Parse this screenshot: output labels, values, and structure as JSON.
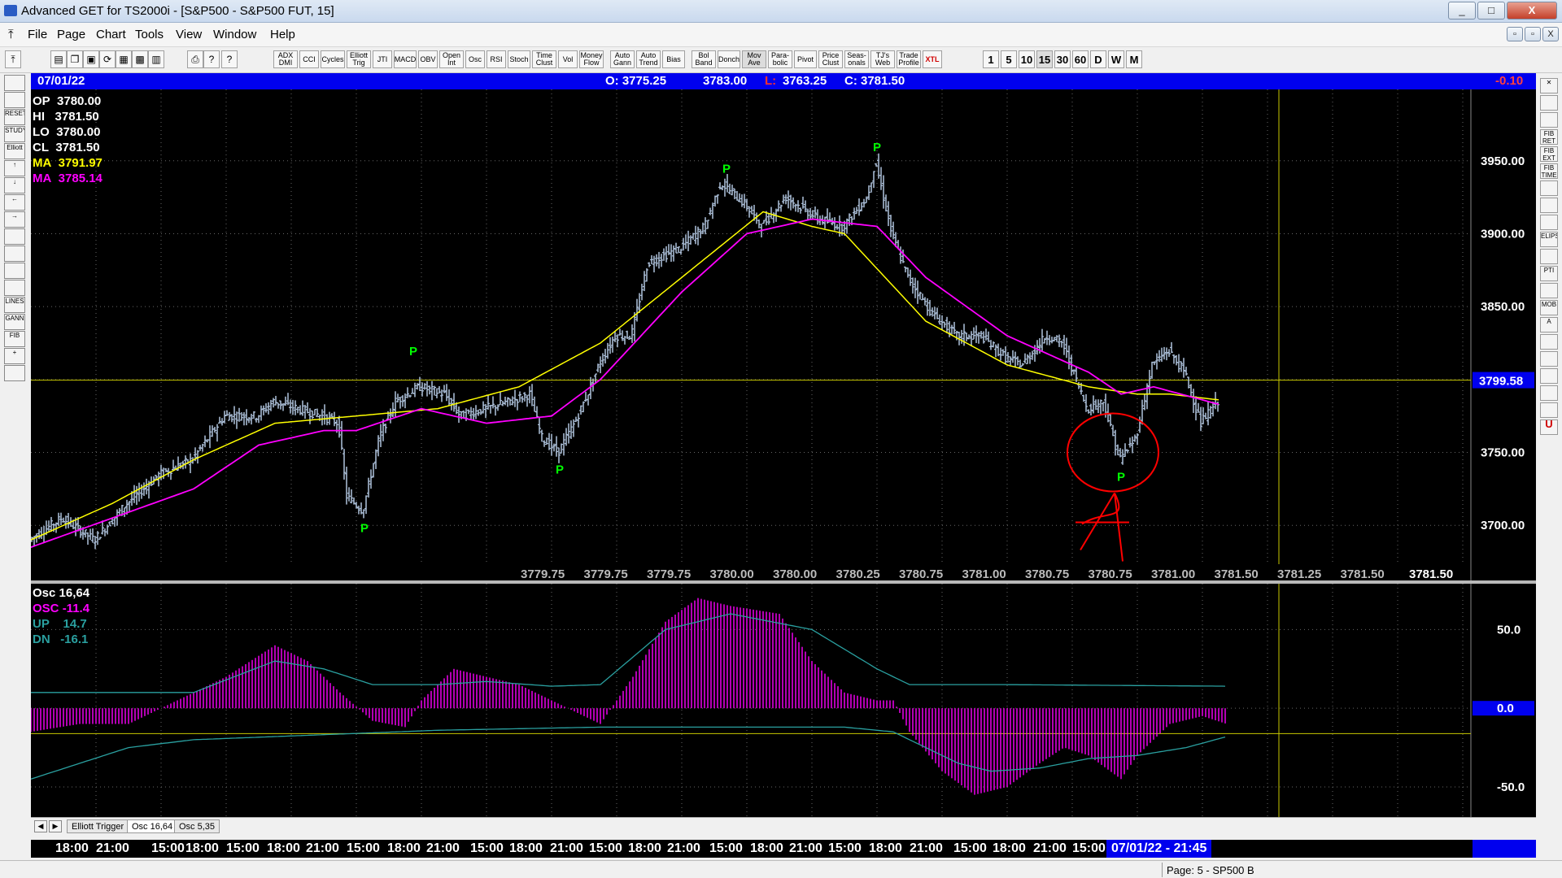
{
  "window": {
    "title": "Advanced GET for TS2000i - [S&P500 - S&P500 FUT, 15]",
    "buttons": [
      "_",
      "□",
      "X"
    ],
    "mdi_buttons": [
      "▫",
      "▫",
      "X"
    ]
  },
  "menu": [
    "File",
    "Page",
    "Chart",
    "Tools",
    "View",
    "Window",
    "Help"
  ],
  "toolbar": {
    "study_buttons": [
      "ADX DMI",
      "CCI",
      "Cycles",
      "Elliott Trig",
      "JTI",
      "MACD",
      "OBV",
      "Open Int",
      "Osc",
      "RSI",
      "Stoch",
      "Time Clust",
      "Vol",
      "Money Flow",
      "Auto Gann",
      "Auto Trend",
      "Bias",
      "Bol Band",
      "Donch",
      "Mov Ave",
      "Para-bolic",
      "Pivot",
      "Price Clust",
      "Seas-onals",
      "TJ's Web",
      "Trade Profile",
      "XTL"
    ],
    "timeframes": [
      "1",
      "5",
      "10",
      "15",
      "30",
      "60",
      "D",
      "W",
      "M"
    ],
    "selected_timeframe": "15"
  },
  "left_tools": [
    "",
    "",
    "RESET",
    "STUDY",
    "Elliott",
    "↑",
    "↓",
    "←",
    "→",
    "",
    "",
    "",
    "",
    "LINES",
    "GANN",
    "FIB",
    "+",
    ""
  ],
  "right_tools": [
    "✕",
    "",
    "",
    "FIB RET",
    "FIB EXT",
    "FIB TIME",
    "",
    "",
    "",
    "ELIPS",
    "",
    "PTI",
    "",
    "MOB",
    "A",
    "",
    "",
    "",
    "",
    "",
    "U"
  ],
  "header_bar": {
    "date": "07/01/22",
    "open": "O: 3775.25",
    "high": "3783.00",
    "low_label": "L:",
    "low": "3763.25",
    "close": "C: 3781.50",
    "change": "-0.10"
  },
  "price_panel": {
    "legend": [
      {
        "label": "OP",
        "value": "3780.00",
        "color": "#ffffff"
      },
      {
        "label": "HI",
        "value": "3781.50",
        "color": "#ffffff"
      },
      {
        "label": "LO",
        "value": "3780.00",
        "color": "#ffffff"
      },
      {
        "label": "CL",
        "value": "3781.50",
        "color": "#ffffff"
      },
      {
        "label": "MA",
        "value": "3791.97",
        "color": "#ffff00"
      },
      {
        "label": "MA",
        "value": "3785.14",
        "color": "#ff00ff"
      }
    ],
    "ticks": [
      "3950.00",
      "3900.00",
      "3850.00",
      "3750.00",
      "3700.00"
    ],
    "current_price_label": "3799.58",
    "bottom_values": [
      "3779.75",
      "3779.75",
      "3779.75",
      "3780.00",
      "3780.00",
      "3780.25",
      "3780.75",
      "3781.00",
      "3780.75",
      "3780.75",
      "3781.00",
      "3781.50",
      "3781.25",
      "3781.50",
      "3781.50"
    ],
    "pivot_marker": "P"
  },
  "osc_panel": {
    "legend": [
      {
        "label": "Osc 16,64",
        "value": "",
        "color": "#ffffff"
      },
      {
        "label": "OSC",
        "value": "-11.4",
        "color": "#ff00ff"
      },
      {
        "label": "UP",
        "value": "14.7",
        "color": "#2aa0a0"
      },
      {
        "label": "DN",
        "value": "-16.1",
        "color": "#2aa0a0"
      }
    ],
    "ticks": [
      "50.0",
      "0.0",
      "-50.0"
    ]
  },
  "tabs": [
    "Elliott Trigger",
    "Osc 16,64",
    "Osc 5,35"
  ],
  "active_tab": "Osc 16,64",
  "time_axis": {
    "labels": [
      "18:00",
      "21:00",
      "15:00",
      "18:00",
      "15:00",
      "18:00",
      "21:00",
      "15:00",
      "18:00",
      "21:00",
      "15:00",
      "18:00",
      "21:00",
      "15:00",
      "18:00",
      "21:00",
      "15:00",
      "18:00",
      "21:00",
      "15:00",
      "18:00",
      "21:00",
      "15:00",
      "18:00",
      "21:00",
      "15:00"
    ],
    "cursor_label": "07/01/22 - 21:45"
  },
  "status": "Page: 5 - SP500 B",
  "colors": {
    "bars": "#b0c4de",
    "ma_fast": "#ffff00",
    "ma_slow": "#ff00ff",
    "pivot": "#00ff00",
    "osc": "#ff00ff",
    "osc_band": "#2aa0a0",
    "annotation": "#ff0000",
    "cursor": "#c8c800"
  },
  "chart_data": {
    "type": "ohlc",
    "instrument": "S&P500 FUT, 15",
    "price_ylim": [
      3670,
      3990
    ],
    "price_path": [
      [
        0,
        3690
      ],
      [
        40,
        3705
      ],
      [
        80,
        3690
      ],
      [
        120,
        3715
      ],
      [
        160,
        3735
      ],
      [
        200,
        3745
      ],
      [
        240,
        3775
      ],
      [
        280,
        3775
      ],
      [
        300,
        3785
      ],
      [
        330,
        3780
      ],
      [
        360,
        3775
      ],
      [
        380,
        3770
      ],
      [
        390,
        3720
      ],
      [
        410,
        3710
      ],
      [
        430,
        3760
      ],
      [
        450,
        3785
      ],
      [
        480,
        3795
      ],
      [
        510,
        3790
      ],
      [
        530,
        3775
      ],
      [
        560,
        3780
      ],
      [
        590,
        3785
      ],
      [
        615,
        3790
      ],
      [
        630,
        3760
      ],
      [
        650,
        3750
      ],
      [
        670,
        3770
      ],
      [
        690,
        3795
      ],
      [
        700,
        3810
      ],
      [
        720,
        3830
      ],
      [
        740,
        3830
      ],
      [
        760,
        3880
      ],
      [
        800,
        3890
      ],
      [
        830,
        3905
      ],
      [
        850,
        3935
      ],
      [
        880,
        3920
      ],
      [
        900,
        3905
      ],
      [
        930,
        3925
      ],
      [
        970,
        3910
      ],
      [
        1000,
        3905
      ],
      [
        1030,
        3925
      ],
      [
        1040,
        3950
      ],
      [
        1060,
        3900
      ],
      [
        1080,
        3870
      ],
      [
        1110,
        3845
      ],
      [
        1140,
        3830
      ],
      [
        1170,
        3830
      ],
      [
        1200,
        3815
      ],
      [
        1220,
        3810
      ],
      [
        1250,
        3830
      ],
      [
        1270,
        3825
      ],
      [
        1300,
        3780
      ],
      [
        1320,
        3785
      ],
      [
        1340,
        3745
      ],
      [
        1360,
        3760
      ],
      [
        1380,
        3810
      ],
      [
        1400,
        3820
      ],
      [
        1420,
        3805
      ],
      [
        1440,
        3770
      ],
      [
        1460,
        3785
      ]
    ],
    "ma_fast_path": [
      [
        0,
        3690
      ],
      [
        100,
        3715
      ],
      [
        200,
        3745
      ],
      [
        300,
        3770
      ],
      [
        400,
        3775
      ],
      [
        500,
        3780
      ],
      [
        600,
        3795
      ],
      [
        700,
        3825
      ],
      [
        800,
        3870
      ],
      [
        900,
        3915
      ],
      [
        960,
        3905
      ],
      [
        1000,
        3900
      ],
      [
        1100,
        3840
      ],
      [
        1200,
        3810
      ],
      [
        1300,
        3795
      ],
      [
        1360,
        3790
      ],
      [
        1400,
        3790
      ],
      [
        1460,
        3786
      ]
    ],
    "ma_slow_path": [
      [
        0,
        3685
      ],
      [
        100,
        3705
      ],
      [
        200,
        3725
      ],
      [
        280,
        3755
      ],
      [
        360,
        3765
      ],
      [
        400,
        3765
      ],
      [
        480,
        3780
      ],
      [
        560,
        3770
      ],
      [
        640,
        3775
      ],
      [
        700,
        3800
      ],
      [
        800,
        3860
      ],
      [
        880,
        3900
      ],
      [
        960,
        3910
      ],
      [
        1040,
        3905
      ],
      [
        1100,
        3870
      ],
      [
        1200,
        3830
      ],
      [
        1300,
        3805
      ],
      [
        1340,
        3790
      ],
      [
        1380,
        3795
      ],
      [
        1460,
        3783
      ]
    ],
    "osc_ylim": [
      -65,
      75
    ],
    "osc_path": [
      [
        0,
        -15
      ],
      [
        60,
        -10
      ],
      [
        120,
        -10
      ],
      [
        180,
        5
      ],
      [
        240,
        20
      ],
      [
        300,
        40
      ],
      [
        340,
        30
      ],
      [
        380,
        10
      ],
      [
        420,
        -8
      ],
      [
        460,
        -12
      ],
      [
        480,
        5
      ],
      [
        520,
        25
      ],
      [
        560,
        20
      ],
      [
        600,
        15
      ],
      [
        640,
        5
      ],
      [
        680,
        -5
      ],
      [
        700,
        -10
      ],
      [
        740,
        20
      ],
      [
        780,
        55
      ],
      [
        820,
        70
      ],
      [
        860,
        65
      ],
      [
        920,
        60
      ],
      [
        960,
        30
      ],
      [
        1000,
        10
      ],
      [
        1040,
        5
      ],
      [
        1060,
        5
      ],
      [
        1080,
        -15
      ],
      [
        1120,
        -40
      ],
      [
        1160,
        -55
      ],
      [
        1200,
        -50
      ],
      [
        1240,
        -35
      ],
      [
        1270,
        -25
      ],
      [
        1300,
        -30
      ],
      [
        1340,
        -45
      ],
      [
        1360,
        -30
      ],
      [
        1400,
        -10
      ],
      [
        1440,
        -5
      ],
      [
        1470,
        -10
      ]
    ],
    "osc_up_path": [
      [
        0,
        10
      ],
      [
        200,
        10
      ],
      [
        300,
        30
      ],
      [
        360,
        25
      ],
      [
        420,
        15
      ],
      [
        500,
        15
      ],
      [
        560,
        17
      ],
      [
        640,
        14
      ],
      [
        700,
        15
      ],
      [
        780,
        50
      ],
      [
        860,
        60
      ],
      [
        960,
        50
      ],
      [
        1040,
        25
      ],
      [
        1080,
        15
      ],
      [
        1200,
        15
      ],
      [
        1470,
        14
      ]
    ],
    "osc_dn_path": [
      [
        0,
        -45
      ],
      [
        60,
        -35
      ],
      [
        120,
        -25
      ],
      [
        200,
        -20
      ],
      [
        300,
        -18
      ],
      [
        400,
        -16
      ],
      [
        500,
        -14
      ],
      [
        600,
        -13
      ],
      [
        700,
        -12
      ],
      [
        800,
        -12
      ],
      [
        900,
        -12
      ],
      [
        1000,
        -12
      ],
      [
        1060,
        -15
      ],
      [
        1100,
        -25
      ],
      [
        1140,
        -35
      ],
      [
        1180,
        -40
      ],
      [
        1240,
        -38
      ],
      [
        1300,
        -32
      ],
      [
        1360,
        -30
      ],
      [
        1420,
        -25
      ],
      [
        1470,
        -18
      ]
    ],
    "pivots": [
      {
        "type": "low",
        "i": 410,
        "price": 3710
      },
      {
        "type": "high",
        "i": 470,
        "price": 3810
      },
      {
        "type": "low",
        "i": 650,
        "price": 3750
      },
      {
        "type": "high",
        "i": 855,
        "price": 3935
      },
      {
        "type": "high",
        "i": 1040,
        "price": 3950
      },
      {
        "type": "low",
        "i": 1340,
        "price": 3745
      }
    ],
    "cursor_price": 3799.58
  }
}
